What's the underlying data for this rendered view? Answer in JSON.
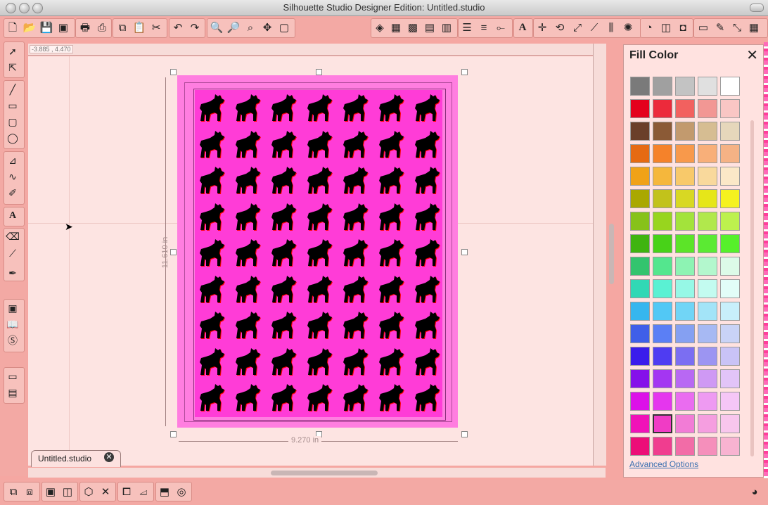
{
  "window": {
    "title": "Silhouette Studio Designer Edition: Untitled.studio"
  },
  "toolbar": {
    "icons": [
      "new-file",
      "open",
      "save",
      "save-to-library",
      "print",
      "print-cut",
      "copy",
      "paste",
      "cut",
      "undo",
      "redo",
      "zoom-in",
      "zoom-out",
      "zoom-selection",
      "drag",
      "fit-page",
      "fill-color",
      "line-color",
      "line-style",
      "fill-pattern",
      "fill-gradient",
      "line-thickness",
      "line-end",
      "knife",
      "text-style",
      "transform",
      "rotate",
      "scale",
      "shear",
      "align",
      "replicate",
      "offset",
      "trace",
      "page-setup",
      "cut-settings",
      "design-store",
      "sketch",
      "lock",
      "register-marks",
      "fullscreen",
      "grid"
    ]
  },
  "canvas": {
    "coordinates": "-3.885 , 4.470",
    "height_dimension": "11.610 in",
    "width_dimension": "9.270 in",
    "dog_rows": 9,
    "dog_cols": 7
  },
  "document_tab": {
    "label": "Untitled.studio",
    "close": "✕"
  },
  "fill_panel": {
    "title": "Fill Color",
    "close": "✕",
    "advanced_label": "Advanced Options",
    "swatch_rows": [
      [
        "#7a7a7a",
        "#a0a0a0",
        "#c3c3c3",
        "#e0e0e0",
        "#ffffff"
      ],
      [
        "#e4001c",
        "#ec2a3b",
        "#f2615f",
        "#f29794",
        "#f9c6c4"
      ],
      [
        "#6a3f2a",
        "#8b5a36",
        "#c29a6e",
        "#d6bd92",
        "#e6d7bb"
      ],
      [
        "#e66a12",
        "#f5822a",
        "#f8994b",
        "#f8af79",
        "#f5b285"
      ],
      [
        "#f0a218",
        "#f5b73c",
        "#f8c96a",
        "#f9d99c",
        "#fbe8c7"
      ],
      [
        "#aaa800",
        "#c2c21b",
        "#d8d823",
        "#e6e619",
        "#f5f21f"
      ],
      [
        "#87c21a",
        "#98d51e",
        "#a3e33b",
        "#b1e84c",
        "#bdf14e"
      ],
      [
        "#3fb40f",
        "#48d218",
        "#5ce428",
        "#5bea33",
        "#56f02b"
      ],
      [
        "#33c46e",
        "#54e68e",
        "#8df3b3",
        "#b3f7cd",
        "#dcfbe8"
      ],
      [
        "#31d8b5",
        "#5af1d3",
        "#96f8e6",
        "#c3fbf0",
        "#e2fdf8"
      ],
      [
        "#36b6ee",
        "#52c8f5",
        "#71d5f6",
        "#a3e4f8",
        "#c8effb"
      ],
      [
        "#3f5fe8",
        "#5b7ff5",
        "#85a0f2",
        "#a7b9f3",
        "#c9d3f6"
      ],
      [
        "#3a1ceb",
        "#4f3cf2",
        "#7b6ef2",
        "#9c95f2",
        "#c9c3f6"
      ],
      [
        "#8511ea",
        "#a436f2",
        "#b868f3",
        "#cf99f4",
        "#e2c4f8"
      ],
      [
        "#dc11e8",
        "#e536ee",
        "#ea6cf0",
        "#ee9af2",
        "#f5c6f6"
      ],
      [
        "#f012b8",
        "#f03cc5",
        "#f27cd6",
        "#f59ee0",
        "#f8c6ed"
      ],
      [
        "#ec0e78",
        "#f03d8f",
        "#f26ca7",
        "#f58fbb",
        "#f8b3d1"
      ]
    ],
    "selected_swatch": "#f03cc5"
  },
  "colors": {
    "chrome": "#f3a9a4",
    "canvas_bg": "#fde4e2",
    "page_outer": "#ff7ee0",
    "pattern_fill": "#ff3cd7",
    "dog_fill": "#000000",
    "dog_shadow": "#ff0000"
  }
}
